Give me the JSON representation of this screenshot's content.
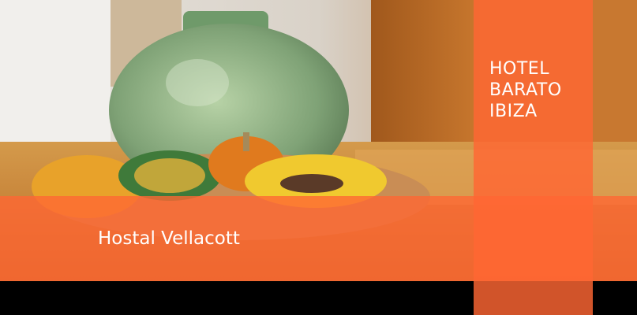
{
  "banner": {
    "title_lines": [
      "HOTEL",
      "BARATO",
      "IBIZA"
    ],
    "hostal_name": "Hostal Vellacott"
  },
  "colors": {
    "overlay_orange": "#ff6633"
  }
}
